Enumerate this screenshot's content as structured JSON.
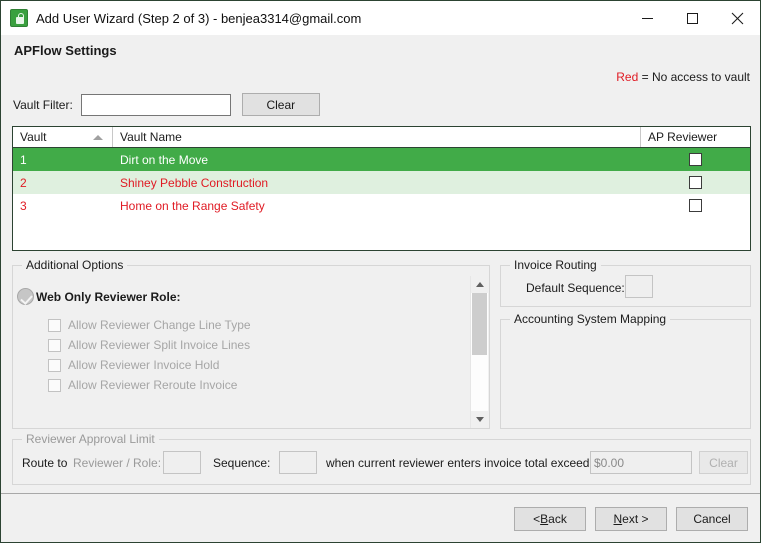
{
  "window": {
    "title": "Add User Wizard (Step 2 of 3) - benjea3314@gmail.com",
    "icon": "vault-app-icon",
    "controls": {
      "minimize": "minimize-icon",
      "maximize": "maximize-icon",
      "close": "close-icon"
    }
  },
  "header": {
    "page_title": "APFlow Settings",
    "legend": {
      "keyword": "Red",
      "description": "= No access to vault",
      "keyword_color": "#e01b24"
    }
  },
  "filter": {
    "label": "Vault Filter:",
    "value": "",
    "placeholder": "",
    "clear_button": "Clear"
  },
  "grid": {
    "columns": [
      "Vault",
      "Vault Name",
      "AP Reviewer"
    ],
    "sort_column": "Vault",
    "sort_direction": "ascending",
    "rows": [
      {
        "vault": "1",
        "name": "Dirt on the Move",
        "ap_reviewer": false,
        "state": "selected"
      },
      {
        "vault": "2",
        "name": "Shiney Pebble Construction",
        "ap_reviewer": false,
        "state": "no-access-alt"
      },
      {
        "vault": "3",
        "name": "Home on the Range Safety",
        "ap_reviewer": false,
        "state": "no-access"
      }
    ],
    "colors": {
      "selected_row": "#41ab48",
      "alt_row": "#dff0df",
      "no_access_text": "#e01b24",
      "selected_text": "#ffffff"
    }
  },
  "additional_options": {
    "title": "Additional Options",
    "web_only_reviewer": {
      "label": "Web Only Reviewer Role:",
      "checked": true,
      "enabled": false
    },
    "sub_options": [
      {
        "label": "Allow Reviewer Change Line Type",
        "checked": false,
        "enabled": false
      },
      {
        "label": "Allow Reviewer Split Invoice Lines",
        "checked": false,
        "enabled": false
      },
      {
        "label": "Allow Reviewer Invoice Hold",
        "checked": false,
        "enabled": false
      },
      {
        "label": "Allow Reviewer Reroute Invoice",
        "checked": false,
        "enabled": false
      }
    ],
    "scrollbar": {
      "up_icon": "chevron-up-icon",
      "down_icon": "chevron-down-icon",
      "thumb_position": "top"
    }
  },
  "invoice_routing": {
    "title": "Invoice Routing",
    "default_sequence_label": "Default Sequence:",
    "default_sequence_value": ""
  },
  "accounting_system_mapping": {
    "title": "Accounting System Mapping"
  },
  "reviewer_approval_limit": {
    "title": "Reviewer Approval Limit",
    "route_to_label": "Route to",
    "reviewer_role_label": "Reviewer / Role:",
    "reviewer_role_value": "",
    "sequence_label": "Sequence:",
    "sequence_value": "",
    "exceeding_label": "when current reviewer enters invoice total exceeding:",
    "amount_value": "$0.00",
    "clear_button": "Clear"
  },
  "footer": {
    "back_prefix": "< ",
    "back_accel": "B",
    "back_suffix": "ack",
    "next_accel": "N",
    "next_suffix": "ext >",
    "cancel": "Cancel"
  }
}
